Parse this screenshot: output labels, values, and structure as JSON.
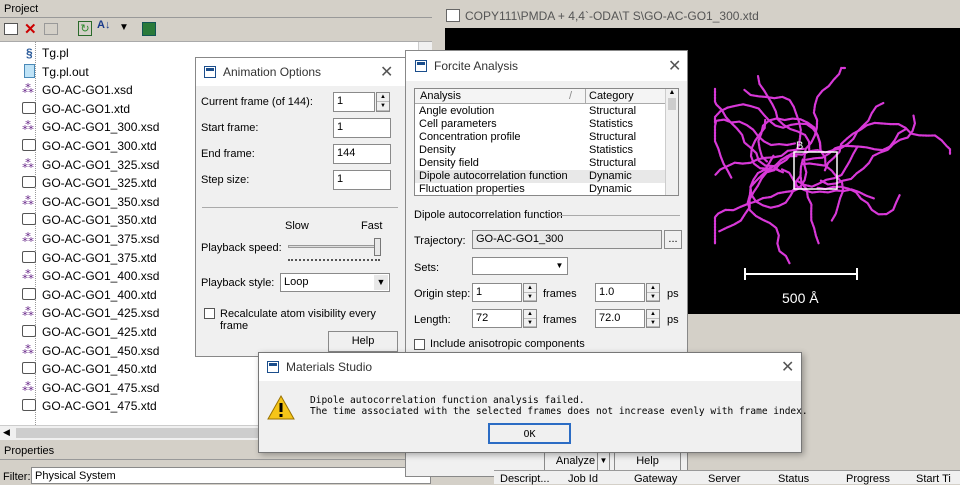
{
  "project": {
    "title": "Project",
    "files": [
      {
        "name": "Tg.pl",
        "type": "script"
      },
      {
        "name": "Tg.pl.out",
        "type": "text"
      },
      {
        "name": "GO-AC-GO1.xsd",
        "type": "xsd"
      },
      {
        "name": "GO-AC-GO1.xtd",
        "type": "xtd"
      },
      {
        "name": "GO-AC-GO1_300.xsd",
        "type": "xsd"
      },
      {
        "name": "GO-AC-GO1_300.xtd",
        "type": "xtd"
      },
      {
        "name": "GO-AC-GO1_325.xsd",
        "type": "xsd"
      },
      {
        "name": "GO-AC-GO1_325.xtd",
        "type": "xtd"
      },
      {
        "name": "GO-AC-GO1_350.xsd",
        "type": "xsd"
      },
      {
        "name": "GO-AC-GO1_350.xtd",
        "type": "xtd"
      },
      {
        "name": "GO-AC-GO1_375.xsd",
        "type": "xsd"
      },
      {
        "name": "GO-AC-GO1_375.xtd",
        "type": "xtd"
      },
      {
        "name": "GO-AC-GO1_400.xsd",
        "type": "xsd"
      },
      {
        "name": "GO-AC-GO1_400.xtd",
        "type": "xtd"
      },
      {
        "name": "GO-AC-GO1_425.xsd",
        "type": "xsd"
      },
      {
        "name": "GO-AC-GO1_425.xtd",
        "type": "xtd"
      },
      {
        "name": "GO-AC-GO1_450.xsd",
        "type": "xsd"
      },
      {
        "name": "GO-AC-GO1_450.xtd",
        "type": "xtd"
      },
      {
        "name": "GO-AC-GO1_475.xsd",
        "type": "xsd"
      },
      {
        "name": "GO-AC-GO1_475.xtd",
        "type": "xtd"
      }
    ]
  },
  "properties": {
    "title": "Properties",
    "filter_label": "Filter:",
    "filter_value": "Physical System"
  },
  "viewer": {
    "title": "COPY111\\PMDA + 4,4`-ODA\\T  S\\GO-AC-GO1_300.xtd",
    "scale_label": "500 Å",
    "axis_label": "B"
  },
  "animation": {
    "title": "Animation Options",
    "current_frame_label": "Current frame (of 144):",
    "current_frame": "1",
    "start_frame_label": "Start frame:",
    "start_frame": "1",
    "end_frame_label": "End frame:",
    "end_frame": "144",
    "step_size_label": "Step size:",
    "step_size": "1",
    "slow": "Slow",
    "fast": "Fast",
    "playback_speed_label": "Playback speed:",
    "playback_style_label": "Playback style:",
    "playback_style": "Loop",
    "recalc_label": "Recalculate atom visibility every frame",
    "help": "Help"
  },
  "forcite": {
    "title": "Forcite Analysis",
    "col_analysis": "Analysis",
    "col_category": "Category",
    "rows": [
      {
        "analysis": "Angle evolution",
        "category": "Structural"
      },
      {
        "analysis": "Cell parameters",
        "category": "Statistics"
      },
      {
        "analysis": "Concentration profile",
        "category": "Structural"
      },
      {
        "analysis": "Density",
        "category": "Statistics"
      },
      {
        "analysis": "Density field",
        "category": "Structural"
      },
      {
        "analysis": "Dipole autocorrelation function",
        "category": "Dynamic"
      },
      {
        "analysis": "Fluctuation properties",
        "category": "Dynamic"
      }
    ],
    "section": "Dipole autocorrelation function",
    "trajectory_label": "Trajectory:",
    "trajectory": "GO-AC-GO1_300",
    "browse": "...",
    "sets_label": "Sets:",
    "origin_label": "Origin step:",
    "origin": "1",
    "origin_unit": "frames",
    "origin_time": "1.0",
    "origin_time_unit": "ps",
    "length_label": "Length:",
    "length": "72",
    "length_unit": "frames",
    "length_time": "72.0",
    "length_time_unit": "ps",
    "aniso_label": "Include anisotropic components",
    "analyze": "Analyze",
    "help": "Help"
  },
  "jobs": {
    "columns": [
      "Descript...",
      "Job Id",
      "Gateway",
      "Server",
      "Status",
      "Progress",
      "Start Ti"
    ]
  },
  "message": {
    "title": "Materials Studio",
    "line1": "Dipole autocorrelation function analysis failed.",
    "line2": "The time associated with the selected frames does not increase evenly with frame index.",
    "ok": "OK"
  }
}
